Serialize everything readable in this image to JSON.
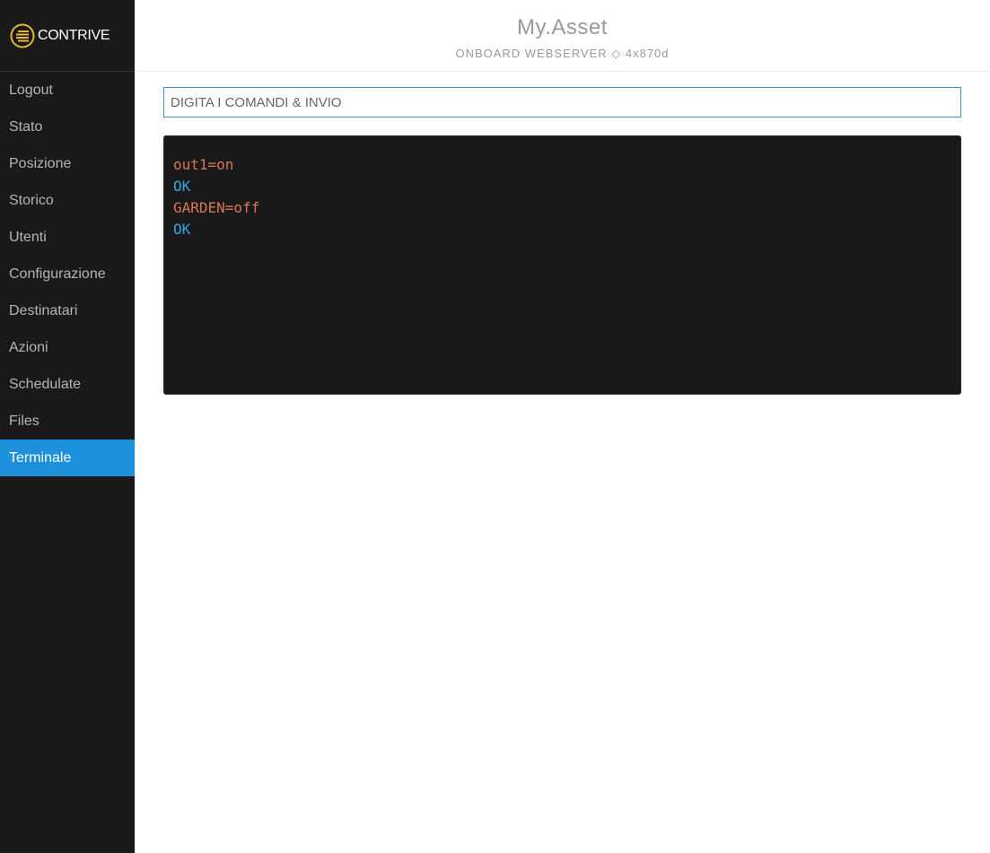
{
  "brand": {
    "logo_text": "CONTRIVE",
    "accent_color": "#e7b53b"
  },
  "sidebar": {
    "items": [
      {
        "label": "Logout"
      },
      {
        "label": "Stato"
      },
      {
        "label": "Posizione"
      },
      {
        "label": "Storico"
      },
      {
        "label": "Utenti"
      },
      {
        "label": "Configurazione"
      },
      {
        "label": "Destinatari"
      },
      {
        "label": "Azioni"
      },
      {
        "label": "Schedulate"
      },
      {
        "label": "Files"
      },
      {
        "label": "Terminale",
        "active": true
      }
    ],
    "active_color": "#1d90dc"
  },
  "header": {
    "title": "My.Asset",
    "subtitle": "ONBOARD WEBSERVER ◇ 4x870d"
  },
  "command_input": {
    "placeholder": "DIGITA I COMANDI & INVIO",
    "value": ""
  },
  "terminal": {
    "lines": [
      {
        "text": "out1=on",
        "kind": "cmd"
      },
      {
        "text": "OK",
        "kind": "resp"
      },
      {
        "text": "GARDEN=off",
        "kind": "cmd"
      },
      {
        "text": "OK",
        "kind": "resp"
      }
    ],
    "command_color": "#d97659",
    "response_color": "#3aa5e3"
  }
}
